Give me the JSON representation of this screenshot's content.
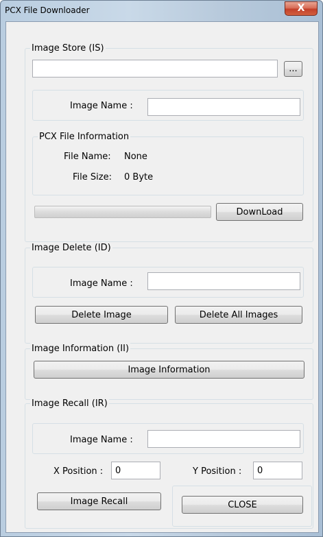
{
  "window": {
    "title": "PCX File Downloader",
    "close_glyph": "X"
  },
  "image_store": {
    "group_label": "Image Store (IS)",
    "path_value": "",
    "browse_label": "...",
    "image_name_label": "Image Name :",
    "image_name_value": "",
    "info_group_label": "PCX File Information",
    "file_name_label": "File Name:",
    "file_name_value": "None",
    "file_size_label": "File Size:",
    "file_size_value": "0 Byte",
    "download_progress": 0,
    "download_label": "DownLoad"
  },
  "image_delete": {
    "group_label": "Image Delete (ID)",
    "image_name_label": "Image Name :",
    "image_name_value": "",
    "delete_label": "Delete Image",
    "delete_all_label": "Delete All Images"
  },
  "image_information": {
    "group_label": "Image Information (II)",
    "button_label": "Image Information"
  },
  "image_recall": {
    "group_label": "Image Recall (IR)",
    "image_name_label": "Image Name :",
    "image_name_value": "",
    "x_label": "X Position :",
    "x_value": "0",
    "y_label": "Y Position :",
    "y_value": "0",
    "recall_label": "Image Recall"
  },
  "close_label": "CLOSE",
  "colors": {
    "title_close_red": "#c2402a",
    "frame_blue": "#b9cde0",
    "dialog_bg": "#f0f0f0"
  }
}
